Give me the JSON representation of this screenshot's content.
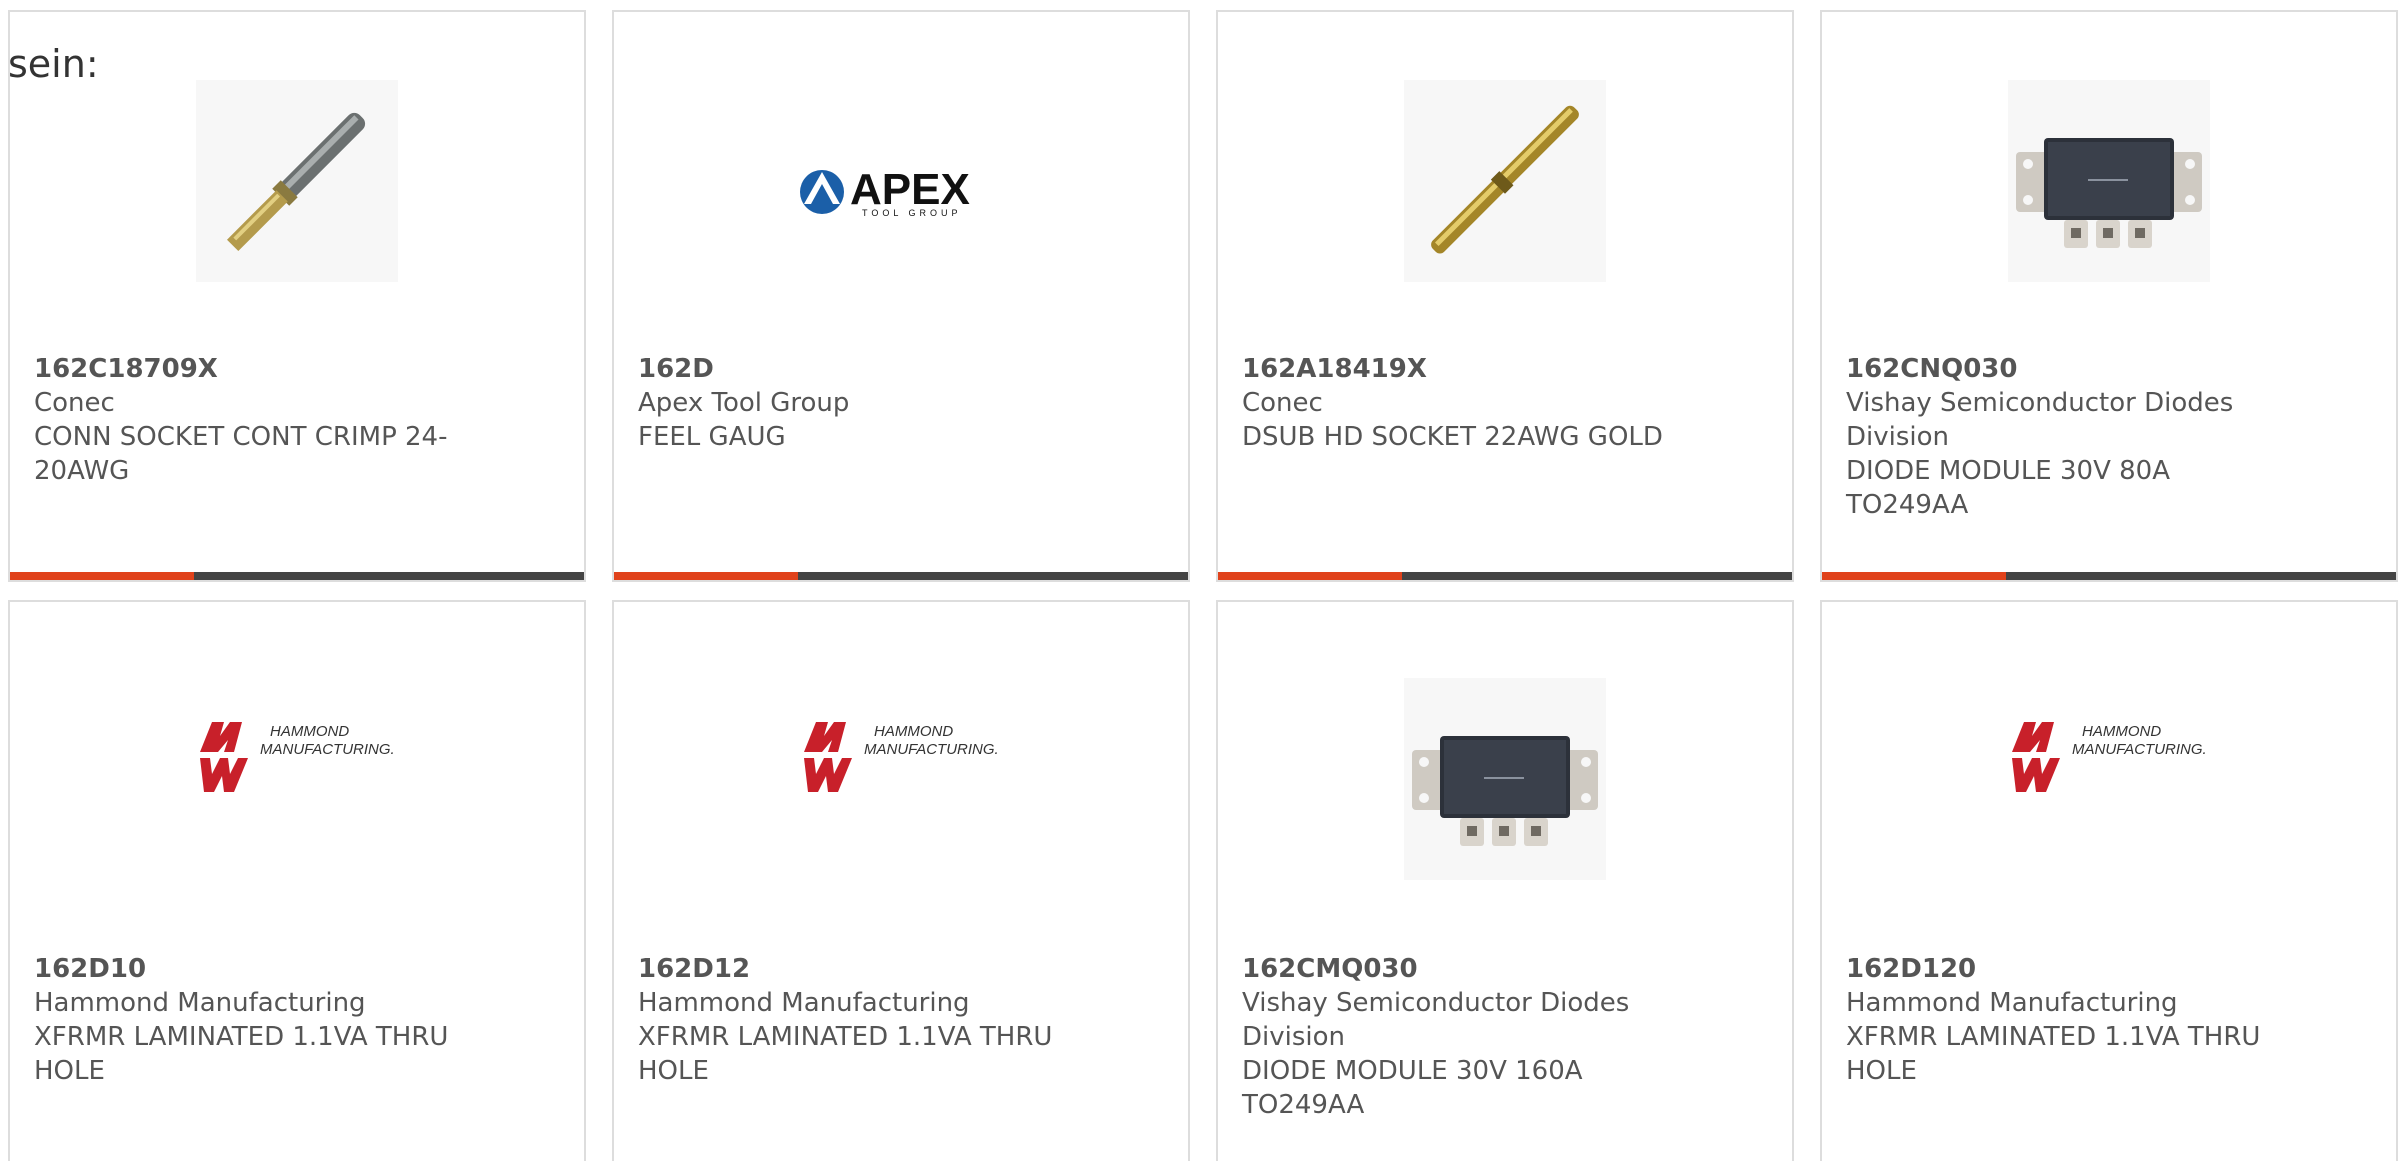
{
  "intro_text": "sein:",
  "accent_color": "#e0421b",
  "bar_color": "#444444",
  "cards": [
    {
      "part_number": "162C18709X",
      "manufacturer": "Conec",
      "description": "CONN SOCKET CONT CRIMP 24-20AWG",
      "image": "pin-contact-silver",
      "progress": 0.32
    },
    {
      "part_number": "162D",
      "manufacturer": "Apex Tool Group",
      "description": "FEEL GAUG",
      "image": "apex-tool-group-logo",
      "logo_text": "APEX",
      "logo_subtext": "TOOL GROUP",
      "progress": 0.32
    },
    {
      "part_number": "162A18419X",
      "manufacturer": "Conec",
      "description": "DSUB HD SOCKET 22AWG GOLD",
      "image": "pin-contact-gold",
      "progress": 0.32
    },
    {
      "part_number": "162CNQ030",
      "manufacturer": "Vishay Semiconductor Diodes Division",
      "description": "DIODE MODULE 30V 80A TO249AA",
      "image": "diode-module",
      "progress": 0.32
    },
    {
      "part_number": "162D10",
      "manufacturer": "Hammond Manufacturing",
      "description": "XFRMR LAMINATED 1.1VA THRU HOLE",
      "image": "hammond-logo",
      "logo_text_1": "HAMMOND",
      "logo_text_2": "MANUFACTURING."
    },
    {
      "part_number": "162D12",
      "manufacturer": "Hammond Manufacturing",
      "description": "XFRMR LAMINATED 1.1VA THRU HOLE",
      "image": "hammond-logo",
      "logo_text_1": "HAMMOND",
      "logo_text_2": "MANUFACTURING."
    },
    {
      "part_number": "162CMQ030",
      "manufacturer": "Vishay Semiconductor Diodes Division",
      "description": "DIODE MODULE 30V 160A TO249AA",
      "image": "diode-module"
    },
    {
      "part_number": "162D120",
      "manufacturer": "Hammond Manufacturing",
      "description": "XFRMR LAMINATED 1.1VA THRU HOLE",
      "image": "hammond-logo",
      "logo_text_1": "HAMMOND",
      "logo_text_2": "MANUFACTURING."
    }
  ]
}
